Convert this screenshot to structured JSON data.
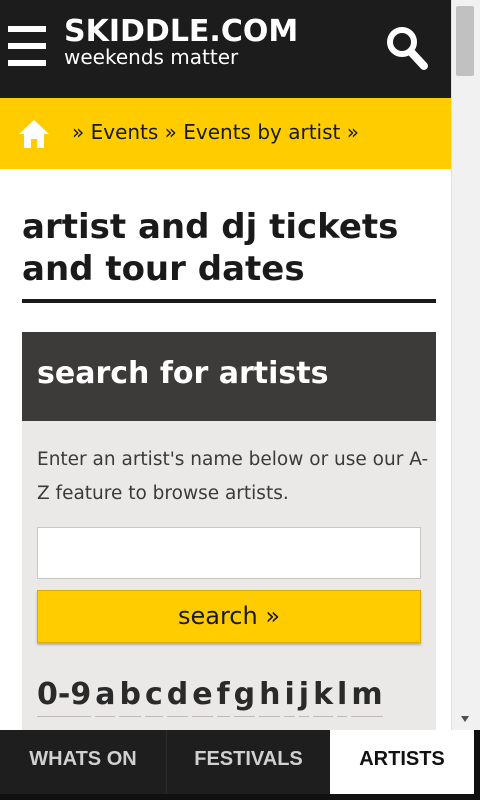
{
  "header": {
    "logo_main": "SKIDDLE.COM",
    "logo_tagline": "weekends matter",
    "menu_icon": "hamburger-icon",
    "search_icon": "search-icon"
  },
  "breadcrumb": {
    "home_icon": "home-icon",
    "sep1": "» ",
    "item1": "Events",
    "sep2": " » ",
    "item2": "Events by artist",
    "sep3": " »"
  },
  "page": {
    "title": "artist and dj tickets and tour dates"
  },
  "search_panel": {
    "title": "search for artists",
    "description": "Enter an artist's name below or use our A-Z feature to browse artists.",
    "input_value": "",
    "button_label": "search »",
    "az_letters": [
      "0-9",
      "a",
      "b",
      "c",
      "d",
      "e",
      "f",
      "g",
      "h",
      "i",
      "j",
      "k",
      "l",
      "m"
    ]
  },
  "tabs": {
    "whats_on": "WHATS ON",
    "festivals": "FESTIVALS",
    "artists": "ARTISTS",
    "active": "ARTISTS"
  },
  "colors": {
    "accent": "#ffcc00",
    "header_bg": "#1c1c1c",
    "panel_head_bg": "#3d3b39",
    "panel_body_bg": "#ebe9e7"
  }
}
